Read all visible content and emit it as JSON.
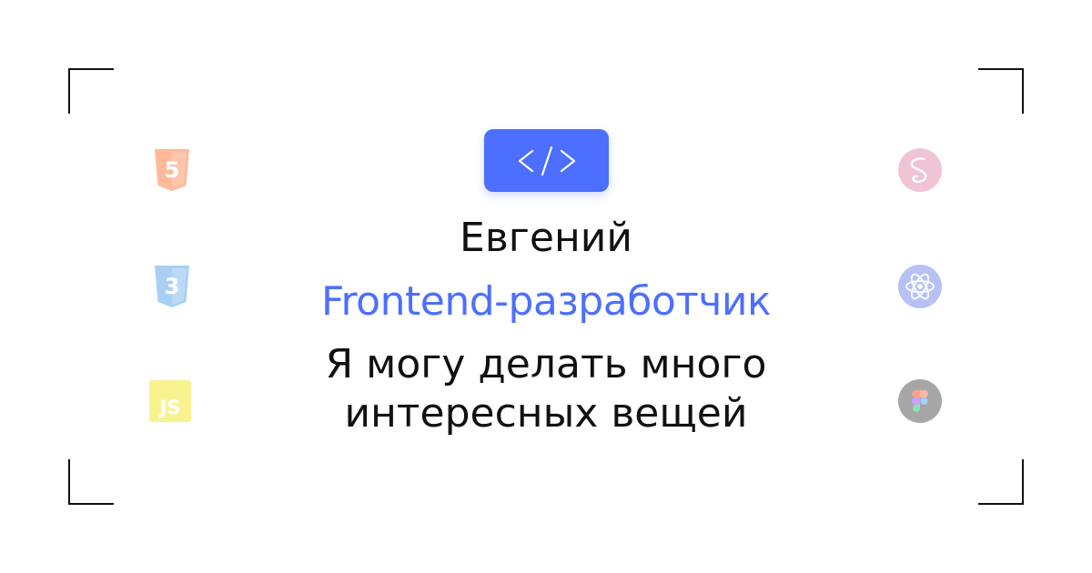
{
  "badge": {
    "icon": "code-brackets-icon",
    "text": "</>",
    "color": "#4C6FFF"
  },
  "profile": {
    "name": "Евгений",
    "role": "Frontend-разработчик",
    "tagline_line1": "Я могу делать много",
    "tagline_line2": "интересных вещей"
  },
  "colors": {
    "accent": "#4C6FFF",
    "text": "#111111",
    "background": "#FFFFFF"
  },
  "tech_left": [
    {
      "icon": "html5-icon",
      "label": "5",
      "color": "#FFB89A"
    },
    {
      "icon": "css3-icon",
      "label": "3",
      "color": "#A9CFF6"
    },
    {
      "icon": "javascript-icon",
      "label": "JS",
      "color": "#F8F291"
    }
  ],
  "tech_right": [
    {
      "icon": "sass-icon",
      "color": "#EFC5D6"
    },
    {
      "icon": "react-icon",
      "color": "#B6C2F6"
    },
    {
      "icon": "figma-icon",
      "color": "#A6A6A6"
    }
  ]
}
